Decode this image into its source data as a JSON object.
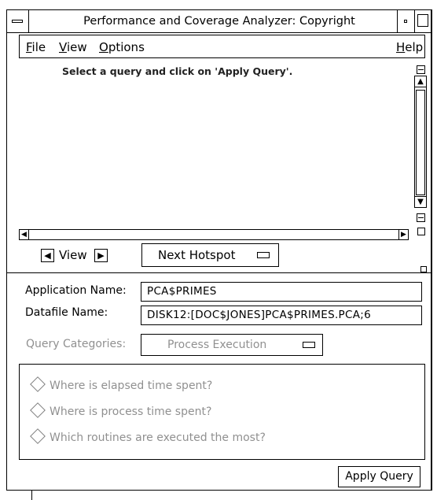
{
  "window": {
    "title": "Performance and Coverage Analyzer: Copyright"
  },
  "menubar": {
    "file": {
      "mnemonic": "F",
      "rest": "ile"
    },
    "view": {
      "mnemonic": "V",
      "rest": "iew"
    },
    "options": {
      "mnemonic": "O",
      "rest": "ptions"
    },
    "help": {
      "mnemonic": "H",
      "rest": "elp"
    }
  },
  "query_list": {
    "instruction": "Select a query and click on 'Apply Query'."
  },
  "view_nav": {
    "label": "View"
  },
  "hotspot_menu": {
    "label": "Next Hotspot"
  },
  "form": {
    "app_name_label": "Application Name:",
    "app_name_value": "PCA$PRIMES",
    "datafile_label": "Datafile Name:",
    "datafile_value": "DISK12:[DOC$JONES]PCA$PRIMES.PCA;6",
    "query_categories_label": "Query Categories:",
    "query_categories_value": "Process Execution"
  },
  "queries": [
    "Where is elapsed time spent?",
    "Where is process time spent?",
    "Which routines are executed the most?"
  ],
  "buttons": {
    "apply_query": "Apply Query"
  }
}
